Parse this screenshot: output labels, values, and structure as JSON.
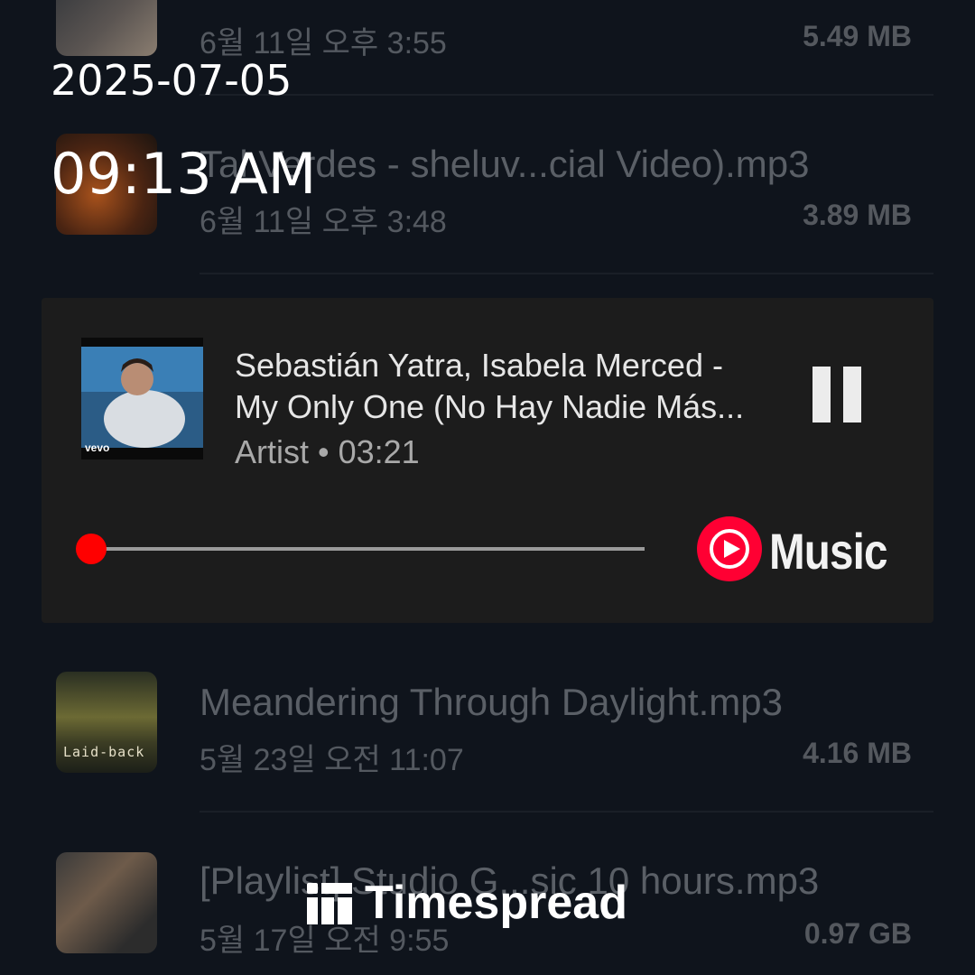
{
  "overlay": {
    "date": "2025-07-05",
    "time": "09:13 AM"
  },
  "files": [
    {
      "name": "",
      "date": "6월 11일 오후 3:55",
      "size": "5.49 MB"
    },
    {
      "name": "Tal Verdes - sheluv...cial Video).mp3",
      "date": "6월 11일 오후 3:48",
      "size": "3.89 MB"
    },
    {
      "name": "Meandering Through Daylight.mp3",
      "date": "5월 23일 오전 11:07",
      "size": "4.16 MB",
      "thumb_text": "Laid-back"
    },
    {
      "name": "[Playlist] Studio G...sic 10 hours.mp3",
      "date": "5월 17일 오전 9:55",
      "size": "0.97 GB"
    }
  ],
  "player": {
    "title_line1": "Sebastián Yatra, Isabela Merced -",
    "title_line2": "My Only One (No Hay Nadie Más...",
    "meta": "Artist • 03:21",
    "art_label": "vevo",
    "progress": 0.0,
    "brand_text": "Music",
    "brand_color": "#ff0033"
  },
  "watermark": {
    "text": "Timespread"
  }
}
